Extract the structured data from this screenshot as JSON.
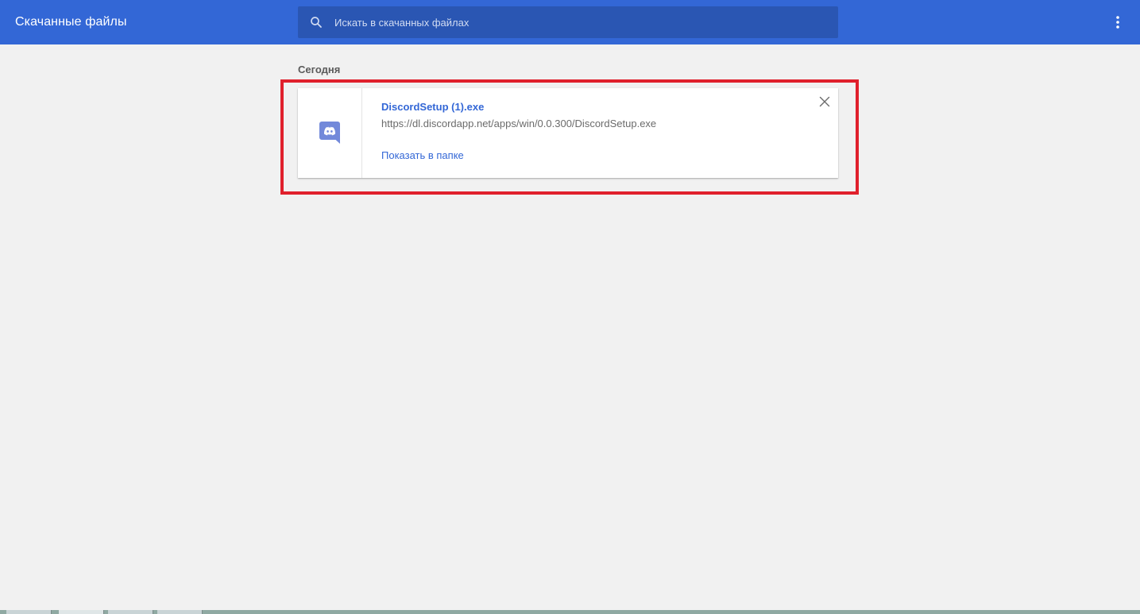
{
  "header": {
    "title": "Скачанные файлы",
    "search": {
      "placeholder": "Искать в скачанных файлах",
      "value": ""
    },
    "menu_icon": "more-vert-icon"
  },
  "downloads": {
    "section_label": "Сегодня",
    "items": [
      {
        "file_name": "DiscordSetup (1).exe",
        "url": "https://dl.discordapp.net/apps/win/0.0.300/DiscordSetup.exe",
        "action_label": "Показать в папке",
        "file_icon": "discord-icon",
        "remove_icon": "close-icon"
      }
    ]
  },
  "colors": {
    "toolbar": "#3367d6",
    "search_background": "#2a56b3",
    "link": "#3367d6",
    "highlight": "#e0202c",
    "discord": "#7289da",
    "page_background": "#f1f1f1"
  }
}
